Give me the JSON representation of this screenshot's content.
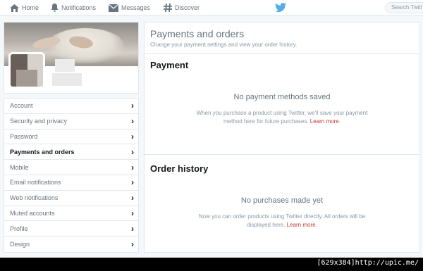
{
  "topnav": {
    "home": "Home",
    "notifications": "Notifications",
    "messages": "Messages",
    "discover": "Discover",
    "search_placeholder": "Search Twitt"
  },
  "colors": {
    "accent": "#55acee",
    "link": "#c0392b",
    "active_text": "#14171a",
    "muted_text": "#66757f"
  },
  "menu": {
    "items": [
      {
        "label": "Account",
        "active": false
      },
      {
        "label": "Security and privacy",
        "active": false
      },
      {
        "label": "Password",
        "active": false
      },
      {
        "label": "Payments and orders",
        "active": true
      },
      {
        "label": "Mobile",
        "active": false
      },
      {
        "label": "Email notifications",
        "active": false
      },
      {
        "label": "Web notifications",
        "active": false
      },
      {
        "label": "Muted accounts",
        "active": false
      },
      {
        "label": "Profile",
        "active": false
      },
      {
        "label": "Design",
        "active": false
      }
    ]
  },
  "main": {
    "title": "Payments and orders",
    "subtitle": "Change your payment settings and view your order history.",
    "payment": {
      "heading": "Payment",
      "empty_title": "No payment methods saved",
      "desc_line1": "When you purchase a product using Twitter, we'll save your payment",
      "desc_line2": "method here for future purchases.",
      "learn_more": "Learn more."
    },
    "orders": {
      "heading": "Order history",
      "empty_title": "No purchases made yet",
      "desc_line1": "Now you can order products using Twitter directly. All orders will be",
      "desc_line2": "displayed here.",
      "learn_more": "Learn more."
    }
  },
  "watermark": "[629x384]http://upic.me/"
}
